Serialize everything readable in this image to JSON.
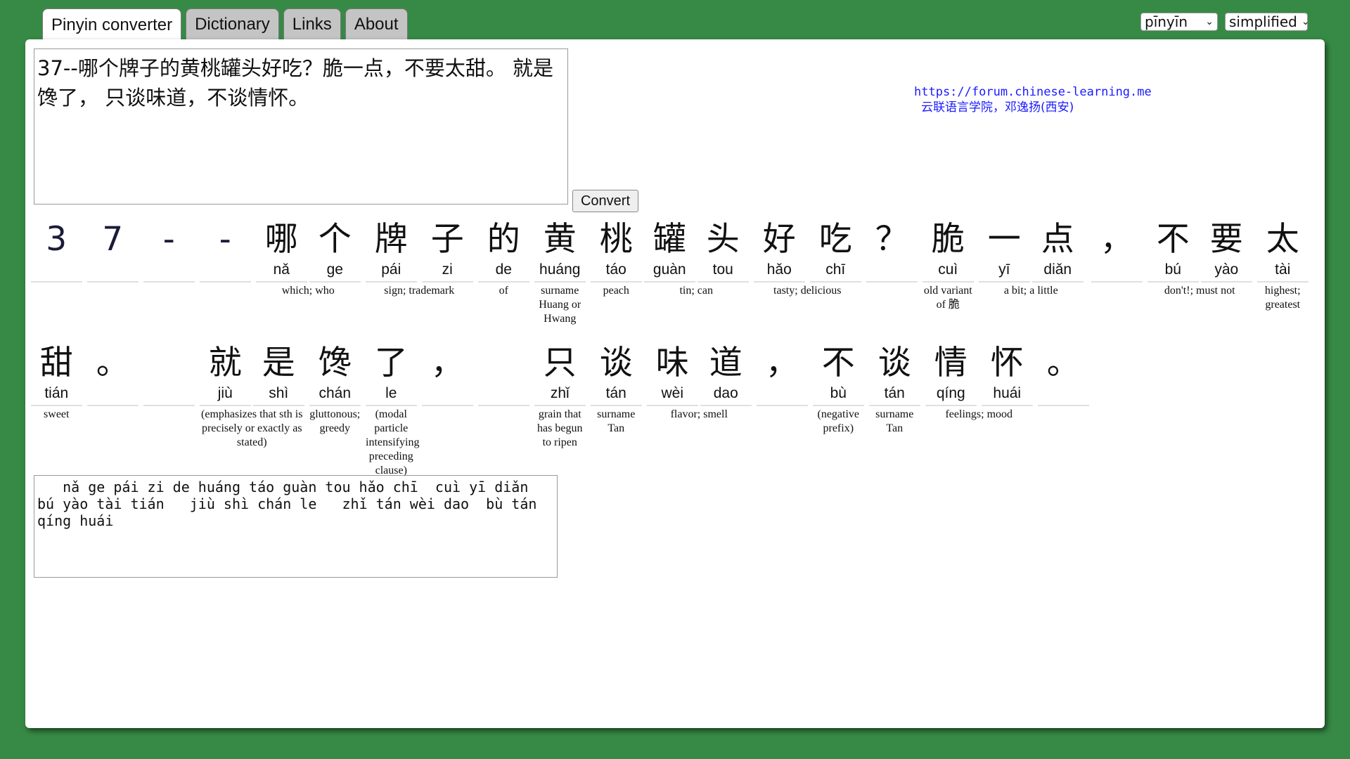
{
  "tabs": [
    {
      "label": "Pinyin converter",
      "active": true
    },
    {
      "label": "Dictionary",
      "active": false
    },
    {
      "label": "Links",
      "active": false
    },
    {
      "label": "About",
      "active": false
    }
  ],
  "selects": {
    "romanization": "pīnyīn",
    "script": "simplified"
  },
  "input_text": "37--哪个牌子的黄桃罐头好吃？脆一点，不要太甜。 就是馋了， 只谈味道，不谈情怀。",
  "convert_label": "Convert",
  "credit": {
    "url": "https://forum.chinese-learning.me",
    "sub": "云联语言学院，邓逸扬(西安)"
  },
  "row1": [
    {
      "hz": "3",
      "py": ""
    },
    {
      "hz": "7",
      "py": ""
    },
    {
      "hz": "-",
      "py": ""
    },
    {
      "hz": "-",
      "py": ""
    },
    {
      "hz": "哪",
      "py": "nǎ"
    },
    {
      "hz": "个",
      "py": "ge"
    },
    {
      "hz": "牌",
      "py": "pái"
    },
    {
      "hz": "子",
      "py": "zi"
    },
    {
      "hz": "的",
      "py": "de"
    },
    {
      "hz": "黄",
      "py": "huáng"
    },
    {
      "hz": "桃",
      "py": "táo"
    },
    {
      "hz": "罐",
      "py": "guàn"
    },
    {
      "hz": "头",
      "py": "tou"
    },
    {
      "hz": "好",
      "py": "hǎo"
    },
    {
      "hz": "吃",
      "py": "chī"
    },
    {
      "hz": "？",
      "py": ""
    },
    {
      "hz": "脆",
      "py": "cuì"
    },
    {
      "hz": "一",
      "py": "yī"
    },
    {
      "hz": "点",
      "py": "diǎn"
    },
    {
      "hz": "，",
      "py": ""
    },
    {
      "hz": "不",
      "py": "bú"
    },
    {
      "hz": "要",
      "py": "yào"
    },
    {
      "hz": "太",
      "py": "tài"
    }
  ],
  "row1_defs": [
    "which; who",
    "sign; trademark",
    "of",
    "surname Huang or Hwang",
    "peach",
    "tin; can",
    "tasty; delicious",
    "old variant of 脆",
    "a bit; a little",
    "don't!; must not",
    "highest; greatest"
  ],
  "row2": [
    {
      "hz": "甜",
      "py": "tián"
    },
    {
      "hz": "。",
      "py": ""
    },
    {
      "hz": "",
      "py": ""
    },
    {
      "hz": "就",
      "py": "jiù"
    },
    {
      "hz": "是",
      "py": "shì"
    },
    {
      "hz": "馋",
      "py": "chán"
    },
    {
      "hz": "了",
      "py": "le"
    },
    {
      "hz": "，",
      "py": ""
    },
    {
      "hz": "",
      "py": ""
    },
    {
      "hz": "只",
      "py": "zhǐ"
    },
    {
      "hz": "谈",
      "py": "tán"
    },
    {
      "hz": "味",
      "py": "wèi"
    },
    {
      "hz": "道",
      "py": "dao"
    },
    {
      "hz": "，",
      "py": ""
    },
    {
      "hz": "不",
      "py": "bù"
    },
    {
      "hz": "谈",
      "py": "tán"
    },
    {
      "hz": "情",
      "py": "qíng"
    },
    {
      "hz": "怀",
      "py": "huái"
    },
    {
      "hz": "。",
      "py": ""
    }
  ],
  "row2_defs": [
    "sweet",
    "(emphasizes that sth is precisely or exactly as stated)",
    "gluttonous; greedy",
    "(modal particle intensifying preceding clause)",
    "grain that has begun to ripen",
    "surname Tan",
    "flavor; smell",
    "(negative prefix)",
    "surname Tan",
    "feelings; mood"
  ],
  "output_text": "   nǎ ge pái zi de huáng táo guàn tou hǎo chī  cuì yī diǎn\nbú yào tài tián   jiù shì chán le   zhǐ tán wèi dao  bù tán\nqíng huái"
}
